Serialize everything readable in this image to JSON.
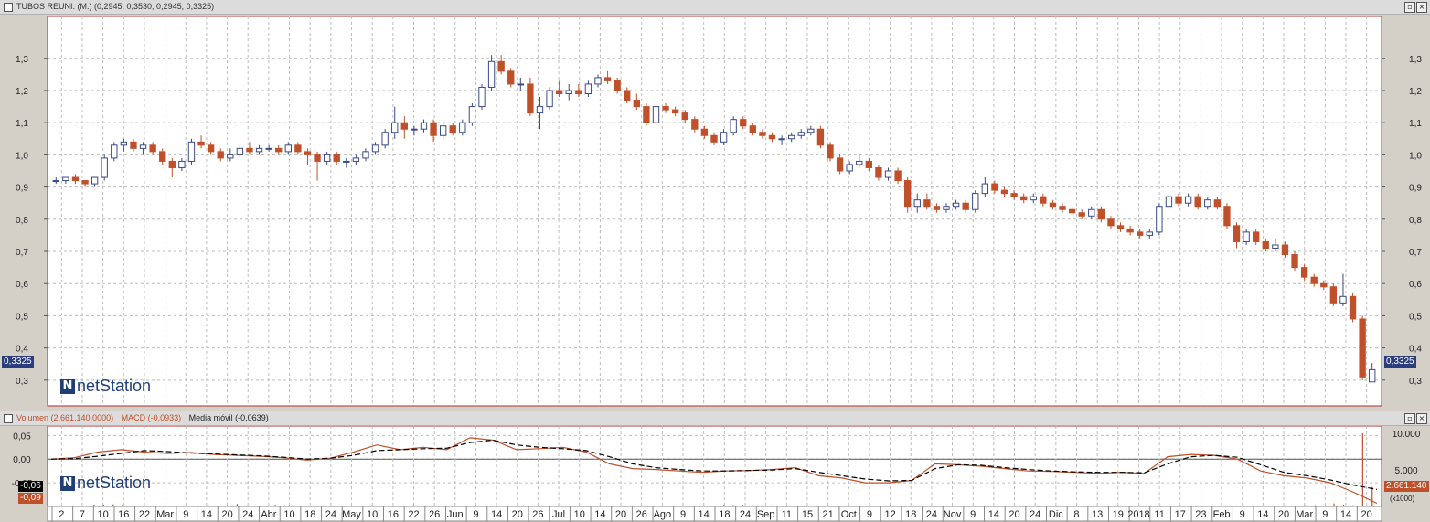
{
  "top_panel": {
    "title": "TUBOS REUNI. (M.) (0,2945, 0,3530, 0,2945, 0,3325)",
    "last_price_label": "0,3325",
    "logo_text": "netStation",
    "y_ticks": [
      "1,3",
      "1,2",
      "1,1",
      "1,0",
      "0,9",
      "0,8",
      "0,7",
      "0,6",
      "0,5",
      "0,4",
      "0,3"
    ]
  },
  "bottom_panel": {
    "title_volume": "Volumen (2.661.140,0000)",
    "title_macd": "MACD (-0,0933)",
    "title_ma": "Media móvil (-0,0639)",
    "left_ticks": [
      "0,05",
      "0,00",
      "-0,05"
    ],
    "right_ticks": [
      "10.000",
      "5.000"
    ],
    "macd_badge": "-0,06",
    "signal_badge": "-0,09",
    "volume_badge": "2.661.140",
    "multiplier_label": "(x1000)",
    "logo_text": "netStation"
  },
  "x_axis_labels": [
    "2",
    "7",
    "10",
    "16",
    "22",
    "Mar",
    "9",
    "14",
    "20",
    "24",
    "Abr",
    "10",
    "18",
    "24",
    "May",
    "10",
    "16",
    "22",
    "26",
    "Jun",
    "9",
    "14",
    "20",
    "26",
    "Jul",
    "10",
    "14",
    "20",
    "26",
    "Ago",
    "9",
    "14",
    "18",
    "24",
    "Sep",
    "11",
    "15",
    "21",
    "Oct",
    "9",
    "12",
    "18",
    "24",
    "Nov",
    "9",
    "14",
    "20",
    "24",
    "Dic",
    "8",
    "13",
    "19",
    "2018",
    "11",
    "17",
    "23",
    "Feb",
    "9",
    "14",
    "20",
    "Mar",
    "9",
    "14",
    "20"
  ],
  "colors": {
    "up_candle": "#3a4a8a",
    "down_candle": "#c0502a",
    "grid": "#bdbdbd",
    "frame": "#b03030",
    "macd_line": "#c0502a",
    "signal_line": "#000000",
    "price_badge": "#2b3d7e"
  },
  "chart_data": [
    {
      "type": "candlestick",
      "title": "TUBOS REUNI. (M.) (0,2945, 0,3530, 0,2945, 0,3325)",
      "ylim": [
        0.22,
        1.43
      ],
      "grid": true,
      "ohlc": [
        [
          0.92,
          0.93,
          0.91,
          0.92
        ],
        [
          0.92,
          0.93,
          0.91,
          0.93
        ],
        [
          0.93,
          0.94,
          0.91,
          0.92
        ],
        [
          0.92,
          0.92,
          0.9,
          0.91
        ],
        [
          0.91,
          0.93,
          0.9,
          0.93
        ],
        [
          0.93,
          1.0,
          0.92,
          0.99
        ],
        [
          0.99,
          1.04,
          0.98,
          1.03
        ],
        [
          1.03,
          1.05,
          1.01,
          1.04
        ],
        [
          1.04,
          1.05,
          1.01,
          1.02
        ],
        [
          1.02,
          1.04,
          1.0,
          1.03
        ],
        [
          1.03,
          1.04,
          1.0,
          1.01
        ],
        [
          1.01,
          1.02,
          0.97,
          0.98
        ],
        [
          0.98,
          0.99,
          0.93,
          0.96
        ],
        [
          0.96,
          0.99,
          0.95,
          0.98
        ],
        [
          0.98,
          1.05,
          0.97,
          1.04
        ],
        [
          1.04,
          1.06,
          1.02,
          1.03
        ],
        [
          1.03,
          1.04,
          1.0,
          1.01
        ],
        [
          1.01,
          1.02,
          0.98,
          0.99
        ],
        [
          0.99,
          1.02,
          0.98,
          1.0
        ],
        [
          1.0,
          1.03,
          0.99,
          1.02
        ],
        [
          1.02,
          1.04,
          1.0,
          1.01
        ],
        [
          1.01,
          1.03,
          1.0,
          1.02
        ],
        [
          1.02,
          1.03,
          1.01,
          1.02
        ],
        [
          1.02,
          1.03,
          1.0,
          1.01
        ],
        [
          1.01,
          1.04,
          1.0,
          1.03
        ],
        [
          1.03,
          1.04,
          1.0,
          1.01
        ],
        [
          1.01,
          1.02,
          0.97,
          1.0
        ],
        [
          1.0,
          1.01,
          0.92,
          0.98
        ],
        [
          0.98,
          1.01,
          0.97,
          1.0
        ],
        [
          1.0,
          1.01,
          0.97,
          0.98
        ],
        [
          0.98,
          0.99,
          0.96,
          0.98
        ],
        [
          0.98,
          1.0,
          0.97,
          0.99
        ],
        [
          0.99,
          1.02,
          0.98,
          1.01
        ],
        [
          1.01,
          1.04,
          1.0,
          1.03
        ],
        [
          1.03,
          1.08,
          1.02,
          1.07
        ],
        [
          1.07,
          1.15,
          1.05,
          1.1
        ],
        [
          1.1,
          1.12,
          1.05,
          1.08
        ],
        [
          1.08,
          1.09,
          1.06,
          1.08
        ],
        [
          1.08,
          1.11,
          1.07,
          1.1
        ],
        [
          1.1,
          1.11,
          1.04,
          1.06
        ],
        [
          1.06,
          1.1,
          1.05,
          1.09
        ],
        [
          1.09,
          1.1,
          1.06,
          1.07
        ],
        [
          1.07,
          1.11,
          1.06,
          1.1
        ],
        [
          1.1,
          1.16,
          1.09,
          1.15
        ],
        [
          1.15,
          1.22,
          1.14,
          1.21
        ],
        [
          1.21,
          1.31,
          1.2,
          1.29
        ],
        [
          1.29,
          1.31,
          1.25,
          1.26
        ],
        [
          1.26,
          1.27,
          1.21,
          1.22
        ],
        [
          1.22,
          1.24,
          1.2,
          1.22
        ],
        [
          1.22,
          1.24,
          1.12,
          1.13
        ],
        [
          1.13,
          1.18,
          1.08,
          1.15
        ],
        [
          1.15,
          1.21,
          1.14,
          1.2
        ],
        [
          1.2,
          1.23,
          1.18,
          1.19
        ],
        [
          1.19,
          1.22,
          1.17,
          1.2
        ],
        [
          1.2,
          1.22,
          1.18,
          1.19
        ],
        [
          1.19,
          1.23,
          1.18,
          1.22
        ],
        [
          1.22,
          1.25,
          1.21,
          1.24
        ],
        [
          1.24,
          1.26,
          1.22,
          1.23
        ],
        [
          1.23,
          1.24,
          1.19,
          1.2
        ],
        [
          1.2,
          1.21,
          1.16,
          1.17
        ],
        [
          1.17,
          1.19,
          1.14,
          1.15
        ],
        [
          1.15,
          1.16,
          1.09,
          1.1
        ],
        [
          1.1,
          1.16,
          1.09,
          1.15
        ],
        [
          1.15,
          1.16,
          1.13,
          1.14
        ],
        [
          1.14,
          1.15,
          1.12,
          1.13
        ],
        [
          1.13,
          1.14,
          1.1,
          1.11
        ],
        [
          1.11,
          1.12,
          1.07,
          1.08
        ],
        [
          1.08,
          1.09,
          1.05,
          1.06
        ],
        [
          1.06,
          1.07,
          1.03,
          1.04
        ],
        [
          1.04,
          1.08,
          1.03,
          1.07
        ],
        [
          1.07,
          1.12,
          1.06,
          1.11
        ],
        [
          1.11,
          1.12,
          1.08,
          1.09
        ],
        [
          1.09,
          1.1,
          1.06,
          1.07
        ],
        [
          1.07,
          1.08,
          1.05,
          1.06
        ],
        [
          1.06,
          1.07,
          1.04,
          1.05
        ],
        [
          1.05,
          1.06,
          1.03,
          1.05
        ],
        [
          1.05,
          1.07,
          1.04,
          1.06
        ],
        [
          1.06,
          1.08,
          1.05,
          1.07
        ],
        [
          1.07,
          1.09,
          1.06,
          1.08
        ],
        [
          1.08,
          1.09,
          1.02,
          1.03
        ],
        [
          1.03,
          1.04,
          0.98,
          0.99
        ],
        [
          0.99,
          1.0,
          0.94,
          0.95
        ],
        [
          0.95,
          0.98,
          0.94,
          0.97
        ],
        [
          0.97,
          1.0,
          0.96,
          0.98
        ],
        [
          0.98,
          0.99,
          0.95,
          0.96
        ],
        [
          0.96,
          0.97,
          0.92,
          0.93
        ],
        [
          0.93,
          0.96,
          0.92,
          0.95
        ],
        [
          0.95,
          0.96,
          0.91,
          0.92
        ],
        [
          0.92,
          0.93,
          0.82,
          0.84
        ],
        [
          0.84,
          0.88,
          0.82,
          0.86
        ],
        [
          0.86,
          0.88,
          0.83,
          0.84
        ],
        [
          0.84,
          0.85,
          0.82,
          0.83
        ],
        [
          0.83,
          0.85,
          0.82,
          0.84
        ],
        [
          0.84,
          0.86,
          0.83,
          0.85
        ],
        [
          0.85,
          0.86,
          0.82,
          0.83
        ],
        [
          0.83,
          0.89,
          0.82,
          0.88
        ],
        [
          0.88,
          0.93,
          0.87,
          0.91
        ],
        [
          0.91,
          0.92,
          0.88,
          0.89
        ],
        [
          0.89,
          0.9,
          0.87,
          0.88
        ],
        [
          0.88,
          0.89,
          0.86,
          0.87
        ],
        [
          0.87,
          0.88,
          0.85,
          0.86
        ],
        [
          0.86,
          0.88,
          0.85,
          0.87
        ],
        [
          0.87,
          0.88,
          0.84,
          0.85
        ],
        [
          0.85,
          0.86,
          0.83,
          0.84
        ],
        [
          0.84,
          0.85,
          0.82,
          0.83
        ],
        [
          0.83,
          0.84,
          0.81,
          0.82
        ],
        [
          0.82,
          0.83,
          0.8,
          0.81
        ],
        [
          0.81,
          0.84,
          0.8,
          0.83
        ],
        [
          0.83,
          0.84,
          0.79,
          0.8
        ],
        [
          0.8,
          0.81,
          0.77,
          0.78
        ],
        [
          0.78,
          0.79,
          0.76,
          0.77
        ],
        [
          0.77,
          0.78,
          0.75,
          0.76
        ],
        [
          0.76,
          0.77,
          0.74,
          0.75
        ],
        [
          0.75,
          0.77,
          0.74,
          0.76
        ],
        [
          0.76,
          0.85,
          0.75,
          0.84
        ],
        [
          0.84,
          0.88,
          0.83,
          0.87
        ],
        [
          0.87,
          0.88,
          0.84,
          0.85
        ],
        [
          0.85,
          0.88,
          0.84,
          0.87
        ],
        [
          0.87,
          0.88,
          0.83,
          0.84
        ],
        [
          0.84,
          0.87,
          0.83,
          0.86
        ],
        [
          0.86,
          0.87,
          0.83,
          0.84
        ],
        [
          0.84,
          0.85,
          0.77,
          0.78
        ],
        [
          0.78,
          0.79,
          0.71,
          0.73
        ],
        [
          0.73,
          0.77,
          0.72,
          0.76
        ],
        [
          0.76,
          0.77,
          0.72,
          0.73
        ],
        [
          0.73,
          0.74,
          0.7,
          0.71
        ],
        [
          0.71,
          0.74,
          0.7,
          0.72
        ],
        [
          0.72,
          0.73,
          0.68,
          0.69
        ],
        [
          0.69,
          0.7,
          0.64,
          0.65
        ],
        [
          0.65,
          0.66,
          0.61,
          0.62
        ],
        [
          0.62,
          0.63,
          0.59,
          0.6
        ],
        [
          0.6,
          0.61,
          0.58,
          0.59
        ],
        [
          0.59,
          0.6,
          0.53,
          0.54
        ],
        [
          0.54,
          0.63,
          0.53,
          0.56
        ],
        [
          0.56,
          0.57,
          0.48,
          0.49
        ],
        [
          0.49,
          0.5,
          0.3,
          0.31
        ],
        [
          0.2945,
          0.353,
          0.2945,
          0.3325
        ]
      ]
    },
    {
      "type": "line",
      "title": "MACD (-0,0933) / Media móvil (-0,0639)",
      "ylim": [
        -0.1,
        0.07
      ],
      "series": [
        {
          "name": "MACD",
          "values": [
            0.0,
            0.003,
            0.015,
            0.02,
            0.015,
            0.012,
            0.014,
            0.01,
            0.008,
            0.006,
            0.003,
            -0.002,
            0.002,
            0.015,
            0.03,
            0.02,
            0.025,
            0.02,
            0.045,
            0.04,
            0.02,
            0.022,
            0.025,
            0.015,
            -0.01,
            -0.02,
            -0.022,
            -0.025,
            -0.028,
            -0.025,
            -0.024,
            -0.022,
            -0.018,
            -0.035,
            -0.04,
            -0.05,
            -0.05,
            -0.045,
            -0.01,
            -0.012,
            -0.015,
            -0.02,
            -0.025,
            -0.026,
            -0.028,
            -0.03,
            -0.028,
            -0.03,
            0.005,
            0.01,
            0.008,
            0.0,
            -0.025,
            -0.035,
            -0.04,
            -0.05,
            -0.07,
            -0.0933
          ]
        },
        {
          "name": "Media móvil",
          "values": [
            0.0,
            0.001,
            0.006,
            0.012,
            0.018,
            0.016,
            0.013,
            0.011,
            0.009,
            0.007,
            0.004,
            0.0,
            0.002,
            0.008,
            0.018,
            0.02,
            0.022,
            0.023,
            0.035,
            0.04,
            0.03,
            0.025,
            0.022,
            0.018,
            0.005,
            -0.01,
            -0.018,
            -0.022,
            -0.025,
            -0.025,
            -0.024,
            -0.023,
            -0.02,
            -0.028,
            -0.035,
            -0.042,
            -0.046,
            -0.045,
            -0.02,
            -0.012,
            -0.013,
            -0.018,
            -0.022,
            -0.025,
            -0.027,
            -0.028,
            -0.028,
            -0.029,
            -0.01,
            0.005,
            0.008,
            0.004,
            -0.012,
            -0.028,
            -0.035,
            -0.044,
            -0.055,
            -0.0639
          ]
        }
      ]
    },
    {
      "type": "bar",
      "title": "Volumen (2.661.140,0000)",
      "ylim": [
        0,
        11000
      ],
      "values": [
        60,
        70,
        60,
        70,
        260,
        250,
        300,
        320,
        100,
        90,
        120,
        80,
        70,
        70,
        60,
        50,
        70,
        80,
        140,
        350,
        90,
        80,
        90,
        220,
        170,
        140,
        80,
        70,
        60,
        70,
        60,
        70,
        60,
        70,
        80,
        70,
        60,
        70,
        50,
        60,
        60,
        50,
        70,
        50,
        40,
        60,
        70,
        60,
        90,
        140,
        110,
        60,
        60,
        60,
        70,
        100,
        60,
        80,
        70,
        60,
        50,
        70,
        60,
        70,
        60,
        80,
        90,
        80,
        140,
        120,
        220,
        180,
        230,
        180,
        160,
        150,
        70,
        90,
        80,
        70,
        60,
        90,
        70,
        80,
        50,
        60,
        70,
        120,
        110,
        60,
        80,
        70,
        60,
        60,
        70,
        60,
        70,
        50,
        70,
        60,
        90,
        70,
        60,
        80,
        90,
        80,
        60,
        60,
        70,
        80,
        60,
        70,
        90,
        100,
        90,
        80,
        70,
        60,
        90,
        80,
        110,
        90,
        70,
        80,
        90,
        120,
        140,
        90,
        80,
        100,
        130,
        160,
        180,
        120,
        420,
        260,
        160,
        10000,
        2661
      ]
    }
  ]
}
